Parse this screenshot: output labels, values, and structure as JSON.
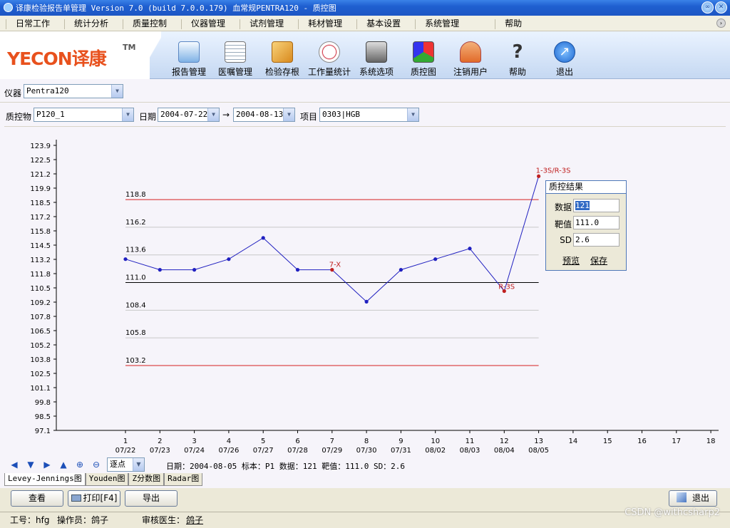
{
  "window": {
    "title": "译康检验报告单管理 Version 7.0 (build 7.0.0.179) 血常规PENTRA120 - 质控图"
  },
  "menu": {
    "items": [
      "日常工作",
      "统计分析",
      "质量控制",
      "仪器管理",
      "试剂管理",
      "耗材管理",
      "基本设置",
      "系统管理",
      "帮助"
    ]
  },
  "logo": {
    "text": "YECON译康",
    "tm": "TM"
  },
  "toolbar": {
    "buttons": [
      {
        "label": "报告管理",
        "icon": "report-icon"
      },
      {
        "label": "医嘱管理",
        "icon": "order-icon"
      },
      {
        "label": "检验存根",
        "icon": "box-icon"
      },
      {
        "label": "工作量统计",
        "icon": "clock-chart-icon"
      },
      {
        "label": "系统选项",
        "icon": "settings-icon"
      },
      {
        "label": "质控图",
        "icon": "cubes-icon"
      },
      {
        "label": "注销用户",
        "icon": "user-logout-icon"
      },
      {
        "label": "帮助",
        "icon": "question-icon"
      },
      {
        "label": "退出",
        "icon": "exit-arrow-icon"
      }
    ]
  },
  "filters": {
    "instrument_label": "仪器",
    "instrument_value": "Pentra120",
    "qc_label": "质控物",
    "qc_value": "P120_1",
    "date_label": "日期",
    "date_from": "2004-07-22",
    "arrow": "→",
    "date_to": "2004-08-13",
    "item_label": "项目",
    "item_value": "0303|HGB"
  },
  "chart_data": {
    "type": "line",
    "y_ticks": [
      "123.9",
      "122.5",
      "121.2",
      "119.9",
      "118.5",
      "117.2",
      "115.8",
      "114.5",
      "113.2",
      "111.8",
      "110.5",
      "109.2",
      "107.8",
      "106.5",
      "105.2",
      "103.8",
      "102.5",
      "101.1",
      "99.8",
      "98.5",
      "97.1"
    ],
    "ylim": [
      97.1,
      123.9
    ],
    "x_numbers": [
      "1",
      "2",
      "3",
      "4",
      "5",
      "6",
      "7",
      "8",
      "9",
      "10",
      "11",
      "12",
      "13",
      "14",
      "15",
      "16",
      "17",
      "18"
    ],
    "x_dates": [
      "07/22",
      "07/23",
      "07/24",
      "07/26",
      "07/27",
      "07/28",
      "07/29",
      "07/30",
      "07/31",
      "08/02",
      "08/03",
      "08/04",
      "08/05"
    ],
    "reference_lines": [
      {
        "label": "118.8",
        "value": 118.8,
        "color": "#d62020"
      },
      {
        "label": "116.2",
        "value": 116.2,
        "color": "#c8c8c8"
      },
      {
        "label": "113.6",
        "value": 113.6,
        "color": "#c8c8c8"
      },
      {
        "label": "111.0",
        "value": 111.0,
        "color": "#000000"
      },
      {
        "label": "108.4",
        "value": 108.4,
        "color": "#c8c8c8"
      },
      {
        "label": "105.8",
        "value": 105.8,
        "color": "#c8c8c8"
      },
      {
        "label": "103.2",
        "value": 103.2,
        "color": "#d62020"
      }
    ],
    "series": [
      {
        "values": [
          113.2,
          112.2,
          112.2,
          113.2,
          115.2,
          112.2,
          112.2,
          109.2,
          112.2,
          113.2,
          114.2,
          110.2,
          121.0
        ],
        "color": "#2020c0"
      }
    ],
    "violations": [
      {
        "index": 6,
        "label": "7-X"
      },
      {
        "index": 11,
        "label": "R-3S"
      },
      {
        "index": 12,
        "label": "1-3S/R-3S"
      }
    ],
    "violation_color": "#c02020"
  },
  "qc_popup": {
    "title": "质控结果",
    "data_label": "数据",
    "data_value": "121",
    "target_label": "靶值",
    "target_value": "111.0",
    "sd_label": "SD",
    "sd_value": "2.6",
    "preview": "预览",
    "save": "保存"
  },
  "nav": {
    "mode_value": "逐点",
    "status": "日期：2004-08-05 标本：P1 数据：121 靶值：111.0 SD：2.6"
  },
  "tabs": [
    "Levey-Jennings图",
    "Youden图",
    "Z分数图",
    "Radar图"
  ],
  "buttons": {
    "view": "查看",
    "print": "打印[F4]",
    "export": "导出",
    "exit": "退出"
  },
  "statusbar": {
    "worker_id": "工号：hfg",
    "operator": "操作员：鸽子",
    "reviewer_label": "审核医生：",
    "reviewer_value": "鸽子"
  },
  "watermark": "CSDN @withcsharp2"
}
